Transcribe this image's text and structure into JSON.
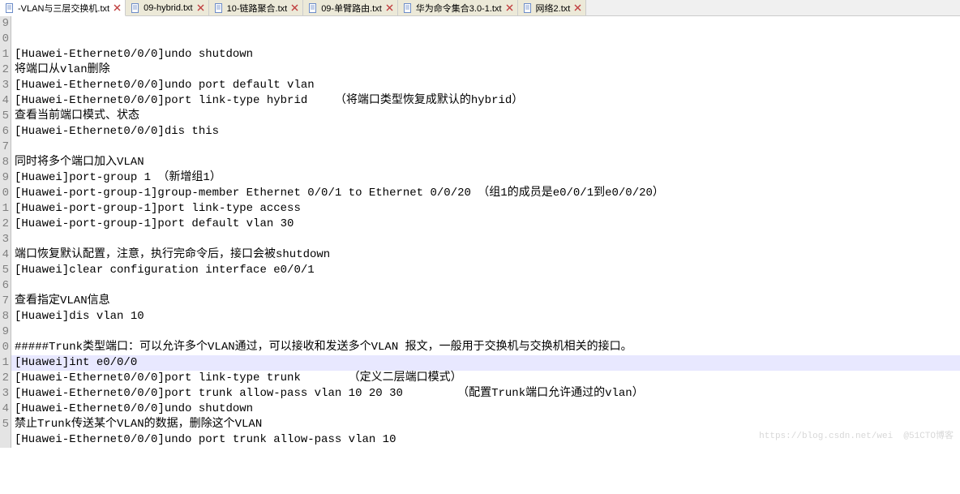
{
  "tabs": [
    {
      "label": "-VLAN与三层交换机.txt",
      "active": true
    },
    {
      "label": "09-hybrid.txt",
      "active": false
    },
    {
      "label": "10-链路聚合.txt",
      "active": false
    },
    {
      "label": "09-单臂路由.txt",
      "active": false
    },
    {
      "label": "华为命令集合3.0-1.txt",
      "active": false
    },
    {
      "label": "网络2.txt",
      "active": false
    }
  ],
  "gutter_start": 9,
  "gutter_count": 27,
  "highlight_index": 20,
  "lines": [
    "[Huawei-Ethernet0/0/0]undo shutdown",
    "将端口从vlan删除",
    "[Huawei-Ethernet0/0/0]undo port default vlan",
    "[Huawei-Ethernet0/0/0]port link-type hybrid    （将端口类型恢复成默认的hybrid）",
    "查看当前端口模式、状态",
    "[Huawei-Ethernet0/0/0]dis this",
    "",
    "同时将多个端口加入VLAN",
    "[Huawei]port-group 1 （新增组1）",
    "[Huawei-port-group-1]group-member Ethernet 0/0/1 to Ethernet 0/0/20 （组1的成员是e0/0/1到e0/0/20）",
    "[Huawei-port-group-1]port link-type access",
    "[Huawei-port-group-1]port default vlan 30",
    "",
    "端口恢复默认配置，注意，执行完命令后，接口会被shutdown",
    "[Huawei]clear configuration interface e0/0/1",
    "",
    "查看指定VLAN信息",
    "[Huawei]dis vlan 10",
    "",
    "#####Trunk类型端口：可以允许多个VLAN通过，可以接收和发送多个VLAN 报文，一般用于交换机与交换机相关的接口。",
    "[Huawei]int e0/0/0",
    "[Huawei-Ethernet0/0/0]port link-type trunk       （定义二层端口模式）",
    "[Huawei-Ethernet0/0/0]port trunk allow-pass vlan 10 20 30        （配置Trunk端口允许通过的vlan）",
    "[Huawei-Ethernet0/0/0]undo shutdown",
    "禁止Trunk传送某个VLAN的数据，删除这个VLAN",
    "[Huawei-Ethernet0/0/0]undo port trunk allow-pass vlan 10",
    ""
  ],
  "watermark": "https://blog.csdn.net/wei  @51CTO博客"
}
